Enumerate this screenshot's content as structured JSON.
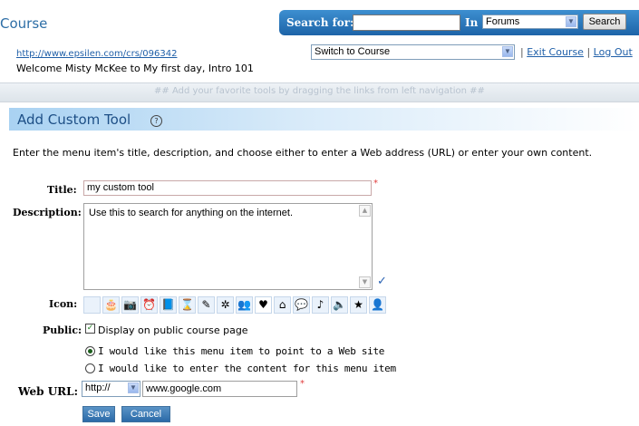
{
  "header": {
    "course_title": "Course",
    "search_label": "Search for:",
    "search_value": "",
    "in_label": "In",
    "scope_selected": "Forums",
    "search_button": "Search",
    "course_url": "http://www.epsilen.com/crs/096342",
    "welcome": "Welcome Misty McKee to My first day, Intro 101",
    "switch_selected": "Switch to Course",
    "link_separator": "|",
    "exit_link": "Exit Course",
    "logout_link": "Log Out",
    "tools_hint": "## Add your favorite tools by dragging the links from left navigation ##"
  },
  "page": {
    "title": "Add Custom Tool",
    "help_glyph": "?",
    "instructions": "Enter the menu item's title, description, and choose either to enter a Web address (URL) or enter your own content."
  },
  "form": {
    "title_label": "Title:",
    "title_value": "my custom tool",
    "required_mark": "*",
    "description_label": "Description:",
    "description_value": "Use this to search for anything on the internet.",
    "icon_label": "Icon:",
    "icons": [
      "blank-icon",
      "cake-icon",
      "camera-icon",
      "clock-icon",
      "book-icon",
      "hourglass-icon",
      "pencil-icon",
      "gear-icon",
      "people-icon",
      "heart-icon",
      "house-icon",
      "chat-icon",
      "music-note-icon",
      "speaker-icon",
      "star-icon",
      "person-icon"
    ],
    "icon_glyphs": [
      "",
      "🎂",
      "📷",
      "⏰",
      "📘",
      "⌛",
      "✎",
      "✲",
      "👥",
      "♥",
      "⌂",
      "💬",
      "♪",
      "🔈",
      "★",
      "👤"
    ],
    "selected_icon_index": 9,
    "public_label": "Public:",
    "public_checked": true,
    "public_text": "Display on public course page",
    "radio_web_text": "I would like this menu item to point to a Web site",
    "radio_content_text": "I would like to enter the content for this menu item",
    "radio_selected": "web",
    "weburl_label": "Web URL:",
    "protocol_selected": "http://",
    "url_value": "www.google.com",
    "save_label": "Save",
    "cancel_label": "Cancel"
  }
}
